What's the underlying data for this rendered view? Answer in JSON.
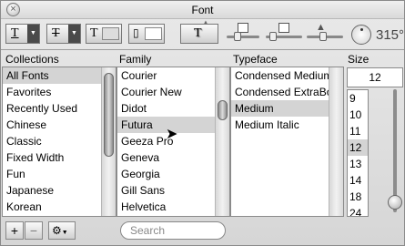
{
  "window": {
    "title": "Font"
  },
  "toolbar": {
    "text_glyph": "T",
    "strike_glyph": "T",
    "color_glyph": "T",
    "shadow_glyph": "T",
    "angle": "315°"
  },
  "columns": {
    "collections": "Collections",
    "family": "Family",
    "typeface": "Typeface",
    "size": "Size"
  },
  "collections": [
    "All Fonts",
    "Favorites",
    "Recently Used",
    "Chinese",
    "Classic",
    "Fixed Width",
    "Fun",
    "Japanese",
    "Korean"
  ],
  "families": [
    "Courier",
    "Courier New",
    "Didot",
    "Futura",
    "Geeza Pro",
    "Geneva",
    "Georgia",
    "Gill Sans",
    "Helvetica"
  ],
  "typefaces": [
    "Condensed Medium",
    "Condensed ExtraBold",
    "Medium",
    "Medium Italic"
  ],
  "size": {
    "value": "12",
    "options": [
      "9",
      "10",
      "11",
      "12",
      "13",
      "14",
      "18",
      "24"
    ]
  },
  "bottom": {
    "add_label": "+",
    "remove_label": "−",
    "search_placeholder": "Search"
  }
}
